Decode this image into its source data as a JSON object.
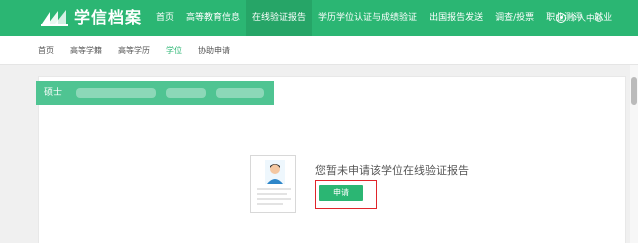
{
  "brand": {
    "name": "学信档案"
  },
  "nav": {
    "items": [
      {
        "label": "首页",
        "active": false
      },
      {
        "label": "高等教育信息",
        "active": false
      },
      {
        "label": "在线验证报告",
        "active": true
      },
      {
        "label": "学历学位认证与成绩验证",
        "active": false
      },
      {
        "label": "出国报告发送",
        "active": false
      },
      {
        "label": "调查/投票",
        "active": false
      },
      {
        "label": "职业测评",
        "active": false
      },
      {
        "label": "就业",
        "active": false
      }
    ],
    "user_label": "个人中心"
  },
  "subnav": {
    "items": [
      {
        "label": "首页",
        "active": false
      },
      {
        "label": "高等学籍",
        "active": false
      },
      {
        "label": "高等学历",
        "active": false
      },
      {
        "label": "学位",
        "active": true
      },
      {
        "label": "协助申请",
        "active": false
      }
    ]
  },
  "degree": {
    "label": "硕士"
  },
  "empty_state": {
    "message": "您暂未申请该学位在线验证报告",
    "button_label": "申请"
  },
  "colors": {
    "brand_green": "#2bb673",
    "highlight_red": "#e0242a"
  },
  "icons": [
    "logo-icon",
    "user-icon",
    "document-avatar-icon"
  ]
}
